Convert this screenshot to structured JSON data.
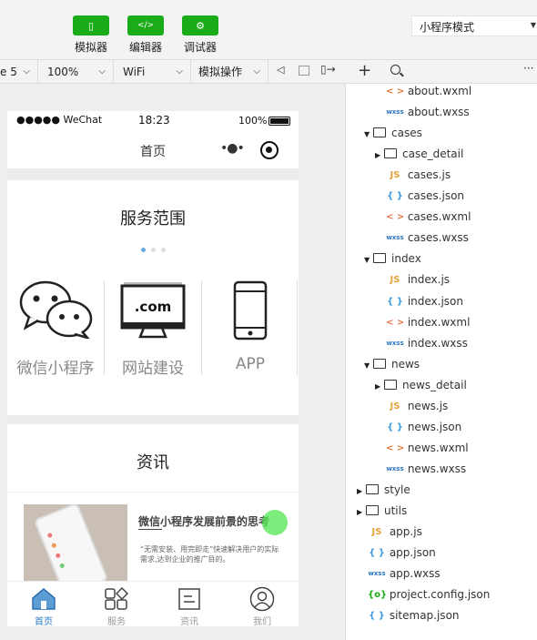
{
  "toolbar": {
    "buttons": [
      {
        "label": "模拟器",
        "glyph": "▯"
      },
      {
        "label": "编辑器",
        "glyph": "</>"
      },
      {
        "label": "调试器",
        "glyph": "⚙"
      }
    ],
    "mode": "小程序模式",
    "colors": {
      "accent": "#1aad19"
    }
  },
  "subbar": {
    "device": "e 5",
    "zoom": "100%",
    "network": "WiFi",
    "operation": "模拟操作"
  },
  "phone": {
    "status": {
      "carrier": "●●●●● WeChat",
      "time": "18:23",
      "battery": "100%"
    },
    "nav_title": "首页",
    "services": {
      "title": "服务范围",
      "items": [
        "微信小程序",
        "网站建设",
        "APP"
      ],
      "dotcom": ".com"
    },
    "news": {
      "title": "资讯",
      "headline": "微信小程序发展前景的思考",
      "summary": "“无需安装、用完即走”快速解决用户的实际需求,达到企业的推广目的。"
    },
    "tabs": [
      "首页",
      "服务",
      "资讯",
      "我们"
    ]
  },
  "tree": {
    "items": [
      {
        "name": "about.wxml",
        "type": "wxml"
      },
      {
        "name": "about.wxss",
        "type": "wxss"
      },
      {
        "name": "cases",
        "type": "folder-open"
      },
      {
        "name": "case_detail",
        "type": "folder-closed"
      },
      {
        "name": "cases.js",
        "type": "js"
      },
      {
        "name": "cases.json",
        "type": "json"
      },
      {
        "name": "cases.wxml",
        "type": "wxml"
      },
      {
        "name": "cases.wxss",
        "type": "wxss"
      },
      {
        "name": "index",
        "type": "folder-open"
      },
      {
        "name": "index.js",
        "type": "js"
      },
      {
        "name": "index.json",
        "type": "json"
      },
      {
        "name": "index.wxml",
        "type": "wxml"
      },
      {
        "name": "index.wxss",
        "type": "wxss"
      },
      {
        "name": "news",
        "type": "folder-open"
      },
      {
        "name": "news_detail",
        "type": "folder-closed"
      },
      {
        "name": "news.js",
        "type": "js"
      },
      {
        "name": "news.json",
        "type": "json"
      },
      {
        "name": "news.wxml",
        "type": "wxml"
      },
      {
        "name": "news.wxss",
        "type": "wxss"
      },
      {
        "name": "style",
        "type": "folder-closed"
      },
      {
        "name": "utils",
        "type": "folder-closed"
      },
      {
        "name": "app.js",
        "type": "js"
      },
      {
        "name": "app.json",
        "type": "json"
      },
      {
        "name": "app.wxss",
        "type": "wxss"
      },
      {
        "name": "project.config.json",
        "type": "config"
      },
      {
        "name": "sitemap.json",
        "type": "json"
      }
    ],
    "icons": {
      "js": "JS",
      "json": "{ }",
      "wxml": "< >",
      "wxss": "wxss",
      "config": "{o}"
    }
  }
}
